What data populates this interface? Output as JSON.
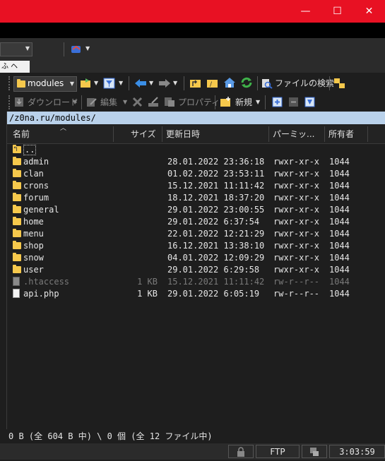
{
  "window": {
    "minimize_glyph": "—",
    "maximize_glyph": "☐",
    "close_glyph": "✕"
  },
  "tab": {
    "label": "ふ ヘ"
  },
  "toolbar": {
    "drive_combo": "modules",
    "find_files": "ファイルの検索",
    "download": "ダウンロード",
    "edit": "編集",
    "properties": "プロパティ",
    "new": "新規"
  },
  "path": "/z0na.ru/modules/",
  "columns": {
    "name": "名前",
    "size": "サイズ",
    "modified": "更新日時",
    "permissions": "パーミッ...",
    "owner": "所有者"
  },
  "rows": [
    {
      "name": "..",
      "size": "",
      "date": "",
      "perm": "",
      "owner": "",
      "type": "up"
    },
    {
      "name": "admin",
      "size": "",
      "date": "28.01.2022 23:36:18",
      "perm": "rwxr-xr-x",
      "owner": "1044",
      "type": "folder"
    },
    {
      "name": "clan",
      "size": "",
      "date": "01.02.2022 23:53:11",
      "perm": "rwxr-xr-x",
      "owner": "1044",
      "type": "folder"
    },
    {
      "name": "crons",
      "size": "",
      "date": "15.12.2021 11:11:42",
      "perm": "rwxr-xr-x",
      "owner": "1044",
      "type": "folder"
    },
    {
      "name": "forum",
      "size": "",
      "date": "18.12.2021 18:37:20",
      "perm": "rwxr-xr-x",
      "owner": "1044",
      "type": "folder"
    },
    {
      "name": "general",
      "size": "",
      "date": "29.01.2022 23:00:55",
      "perm": "rwxr-xr-x",
      "owner": "1044",
      "type": "folder"
    },
    {
      "name": "home",
      "size": "",
      "date": "29.01.2022 6:37:54",
      "perm": "rwxr-xr-x",
      "owner": "1044",
      "type": "folder"
    },
    {
      "name": "menu",
      "size": "",
      "date": "22.01.2022 12:21:29",
      "perm": "rwxr-xr-x",
      "owner": "1044",
      "type": "folder"
    },
    {
      "name": "shop",
      "size": "",
      "date": "16.12.2021 13:38:10",
      "perm": "rwxr-xr-x",
      "owner": "1044",
      "type": "folder"
    },
    {
      "name": "snow",
      "size": "",
      "date": "04.01.2022 12:09:29",
      "perm": "rwxr-xr-x",
      "owner": "1044",
      "type": "folder"
    },
    {
      "name": "user",
      "size": "",
      "date": "29.01.2022 6:29:58",
      "perm": "rwxr-xr-x",
      "owner": "1044",
      "type": "folder"
    },
    {
      "name": ".htaccess",
      "size": "1 KB",
      "date": "15.12.2021 11:11:42",
      "perm": "rw-r--r--",
      "owner": "1044",
      "type": "hidden"
    },
    {
      "name": "api.php",
      "size": "1 KB",
      "date": "29.01.2022 6:05:19",
      "perm": "rw-r--r--",
      "owner": "1044",
      "type": "file"
    }
  ],
  "status": "0 B (全 604 B 中) \\ 0 個 (全 12 ファイル中)",
  "bottom": {
    "protocol": "FTP",
    "time": "3:03:59"
  },
  "colors": {
    "titlebar": "#e81123",
    "pathbar": "#b9d1ea",
    "folder": "#f5c84c"
  }
}
